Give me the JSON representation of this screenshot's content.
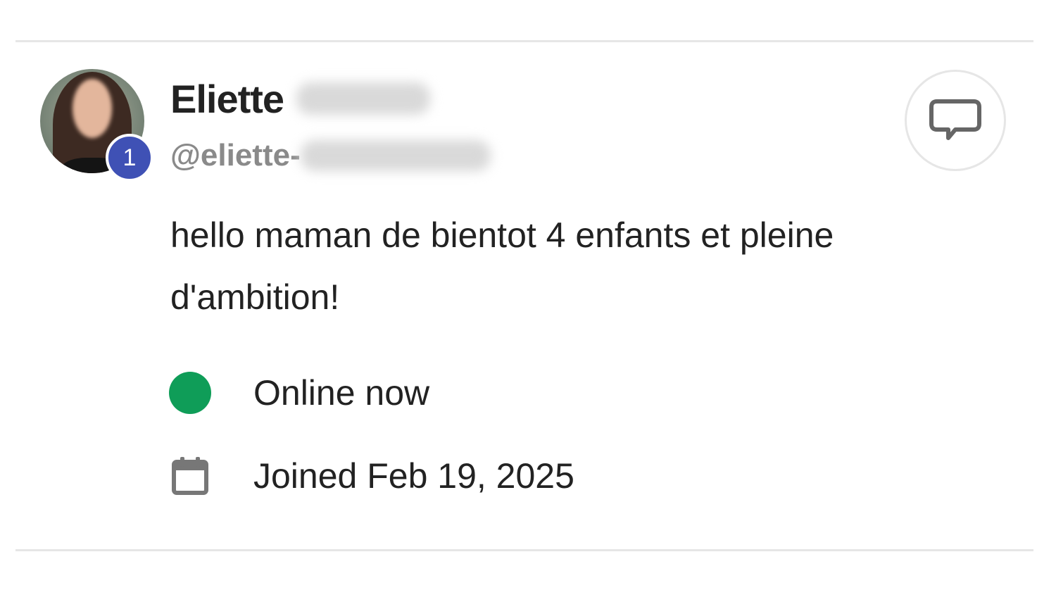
{
  "profile": {
    "name": "Eliette",
    "handle": "@eliette-",
    "badge_count": "1",
    "bio": "hello maman de bientot 4 enfants et pleine d'ambition!",
    "status": "Online now",
    "joined": "Joined Feb 19, 2025"
  },
  "icons": {
    "message": "message-bubble-icon",
    "status": "online-status-dot",
    "joined": "calendar-icon"
  },
  "colors": {
    "badge": "#3f51b5",
    "online": "#0f9d58",
    "handle": "#8a8a8a",
    "divider": "#e6e6e6"
  }
}
